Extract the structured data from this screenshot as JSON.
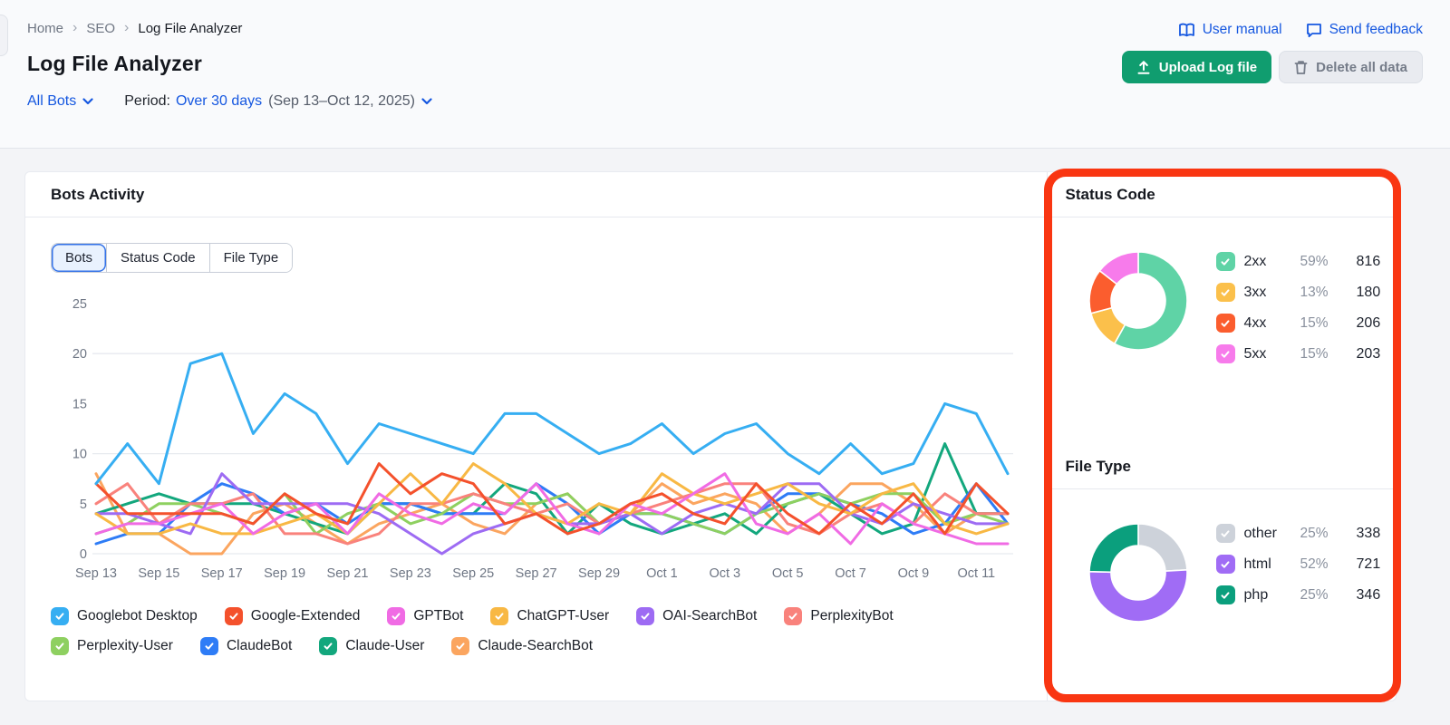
{
  "page": {
    "breadcrumb": [
      "Home",
      "SEO",
      "Log File Analyzer"
    ],
    "title": "Log File Analyzer",
    "filters": {
      "bots_filter": "All Bots",
      "period_label": "Period:",
      "period_value": "Over 30 days",
      "period_range": "(Sep 13–Oct 12, 2025)"
    },
    "links": {
      "user_manual": "User manual",
      "send_feedback": "Send feedback"
    },
    "buttons": {
      "upload": "Upload Log file",
      "delete": "Delete all data"
    }
  },
  "theme": {
    "link_blue": "#1557E0",
    "upload_green": "#109D6F",
    "highlight_red": "#F93612",
    "axis_gray": "#6E7684",
    "grid_gray": "#E7EAEF"
  },
  "bots_activity": {
    "title": "Bots Activity",
    "tabs": [
      {
        "label": "Bots",
        "active": true
      },
      {
        "label": "Status Code",
        "active": false
      },
      {
        "label": "File Type",
        "active": false
      }
    ]
  },
  "status_panel": {
    "title": "Status Code"
  },
  "filetype_panel": {
    "title": "File Type"
  },
  "chart_data": [
    {
      "type": "line",
      "title": "Bots Activity",
      "x": [
        "Sep 13",
        "Sep 14",
        "Sep 15",
        "Sep 16",
        "Sep 17",
        "Sep 18",
        "Sep 19",
        "Sep 20",
        "Sep 21",
        "Sep 22",
        "Sep 23",
        "Sep 24",
        "Sep 25",
        "Sep 26",
        "Sep 27",
        "Sep 28",
        "Sep 29",
        "Sep 30",
        "Oct 1",
        "Oct 2",
        "Oct 3",
        "Oct 4",
        "Oct 5",
        "Oct 6",
        "Oct 7",
        "Oct 8",
        "Oct 9",
        "Oct 10",
        "Oct 11",
        "Oct 12"
      ],
      "x_tick_labels": [
        "Sep 13",
        "Sep 15",
        "Sep 17",
        "Sep 19",
        "Sep 21",
        "Sep 23",
        "Sep 25",
        "Sep 27",
        "Sep 29",
        "Oct 1",
        "Oct 3",
        "Oct 5",
        "Oct 7",
        "Oct 9",
        "Oct 11"
      ],
      "tick_every": 2,
      "ylim": [
        0,
        25
      ],
      "yticks": [
        0,
        5,
        10,
        15,
        20,
        25
      ],
      "gridlines_at": [
        0,
        10,
        20
      ],
      "legend_position": "bottom",
      "series": [
        {
          "name": "Googlebot Desktop",
          "color": "#36AEF2",
          "values": [
            7,
            11,
            7,
            19,
            20,
            12,
            16,
            14,
            9,
            13,
            12,
            11,
            10,
            14,
            14,
            12,
            10,
            11,
            13,
            10,
            12,
            13,
            10,
            8,
            11,
            8,
            9,
            15,
            14,
            8
          ]
        },
        {
          "name": "Google-Extended",
          "color": "#F4512C",
          "values": [
            7,
            4,
            4,
            4,
            4,
            3,
            6,
            4,
            3,
            9,
            6,
            8,
            7,
            3,
            4,
            2,
            3,
            5,
            6,
            4,
            3,
            7,
            4,
            2,
            5,
            3,
            6,
            2,
            7,
            4
          ]
        },
        {
          "name": "GPTBot",
          "color": "#F06BE4",
          "values": [
            2,
            3,
            3,
            4,
            5,
            2,
            4,
            5,
            2,
            6,
            4,
            3,
            5,
            4,
            7,
            3,
            2,
            5,
            4,
            6,
            8,
            3,
            2,
            4,
            1,
            5,
            3,
            2,
            1,
            1
          ]
        },
        {
          "name": "ChatGPT-User",
          "color": "#F8B844",
          "values": [
            4,
            2,
            2,
            3,
            2,
            2,
            3,
            4,
            2,
            5,
            8,
            5,
            9,
            7,
            4,
            3,
            5,
            4,
            8,
            6,
            5,
            6,
            7,
            5,
            4,
            6,
            7,
            3,
            2,
            3
          ]
        },
        {
          "name": "OAI-SearchBot",
          "color": "#9D6BF3",
          "values": [
            4,
            4,
            3,
            2,
            8,
            5,
            5,
            5,
            5,
            4,
            2,
            0,
            2,
            3,
            4,
            3,
            3,
            4,
            2,
            4,
            5,
            4,
            7,
            7,
            4,
            3,
            5,
            4,
            3,
            3
          ]
        },
        {
          "name": "PerplexityBot",
          "color": "#F9827C",
          "values": [
            5,
            7,
            3,
            5,
            5,
            6,
            2,
            2,
            1,
            2,
            5,
            5,
            6,
            5,
            4,
            5,
            3,
            4,
            5,
            6,
            7,
            7,
            3,
            2,
            4,
            5,
            3,
            6,
            4,
            4
          ]
        },
        {
          "name": "Perplexity-User",
          "color": "#8ED060",
          "values": [
            2,
            3,
            5,
            5,
            4,
            3,
            6,
            2,
            4,
            5,
            3,
            4,
            6,
            5,
            5,
            6,
            3,
            4,
            4,
            3,
            2,
            4,
            5,
            6,
            5,
            6,
            6,
            3,
            4,
            3
          ]
        },
        {
          "name": "ClaudeBot",
          "color": "#2E7CF6",
          "values": [
            1,
            2,
            2,
            5,
            7,
            6,
            4,
            5,
            3,
            5,
            5,
            4,
            4,
            4,
            7,
            5,
            2,
            4,
            4,
            3,
            2,
            4,
            6,
            6,
            5,
            4,
            2,
            3,
            7,
            3
          ]
        },
        {
          "name": "Claude-User",
          "color": "#13A77D",
          "values": [
            4,
            5,
            6,
            5,
            5,
            5,
            4,
            3,
            2,
            5,
            5,
            4,
            4,
            7,
            6,
            2,
            5,
            3,
            2,
            3,
            4,
            2,
            5,
            6,
            4,
            2,
            3,
            11,
            4,
            4
          ]
        },
        {
          "name": "Claude-SearchBot",
          "color": "#FBA55F",
          "values": [
            8,
            2,
            2,
            0,
            0,
            4,
            5,
            3,
            1,
            3,
            4,
            5,
            3,
            2,
            5,
            6,
            3,
            4,
            7,
            5,
            6,
            5,
            2,
            4,
            7,
            7,
            5,
            2,
            4,
            4
          ]
        }
      ]
    },
    {
      "type": "donut",
      "title": "Status Code",
      "slices": [
        {
          "label": "2xx",
          "pct": "59%",
          "value": 816,
          "color": "#5FD3A6"
        },
        {
          "label": "3xx",
          "pct": "13%",
          "value": 180,
          "color": "#FBC04B"
        },
        {
          "label": "4xx",
          "pct": "15%",
          "value": 206,
          "color": "#FB5D2E"
        },
        {
          "label": "5xx",
          "pct": "15%",
          "value": 203,
          "color": "#F77BEB"
        }
      ]
    },
    {
      "type": "donut",
      "title": "File Type",
      "slices": [
        {
          "label": "other",
          "pct": "25%",
          "value": 338,
          "color": "#CDD2DA"
        },
        {
          "label": "html",
          "pct": "52%",
          "value": 721,
          "color": "#A06CF5"
        },
        {
          "label": "php",
          "pct": "25%",
          "value": 346,
          "color": "#0B9F7D"
        }
      ]
    }
  ]
}
